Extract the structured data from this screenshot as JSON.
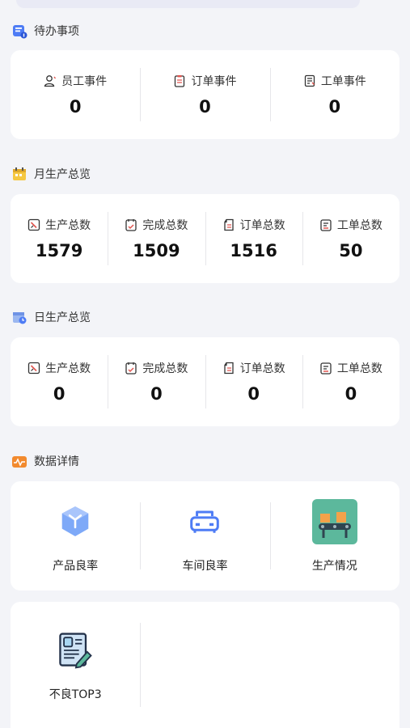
{
  "pending": {
    "title": "待办事项",
    "items": [
      {
        "label": "员工事件",
        "value": "0"
      },
      {
        "label": "订单事件",
        "value": "0"
      },
      {
        "label": "工单事件",
        "value": "0"
      }
    ]
  },
  "monthly": {
    "title": "月生产总览",
    "items": [
      {
        "label": "生产总数",
        "value": "1579"
      },
      {
        "label": "完成总数",
        "value": "1509"
      },
      {
        "label": "订单总数",
        "value": "1516"
      },
      {
        "label": "工单总数",
        "value": "50"
      }
    ]
  },
  "daily": {
    "title": "日生产总览",
    "items": [
      {
        "label": "生产总数",
        "value": "0"
      },
      {
        "label": "完成总数",
        "value": "0"
      },
      {
        "label": "订单总数",
        "value": "0"
      },
      {
        "label": "工单总数",
        "value": "0"
      }
    ]
  },
  "details": {
    "title": "数据详情",
    "tiles": [
      {
        "label": "产品良率",
        "icon": "cube-icon"
      },
      {
        "label": "车间良率",
        "icon": "workshop-icon"
      },
      {
        "label": "生产情况",
        "icon": "conveyor-icon"
      },
      {
        "label": "不良TOP3",
        "icon": "report-icon"
      }
    ]
  },
  "colors": {
    "accent_blue": "#4e7cf5",
    "accent_red": "#e0554f",
    "accent_orange": "#f28a2e",
    "teal_tile": "#5cb89c"
  }
}
